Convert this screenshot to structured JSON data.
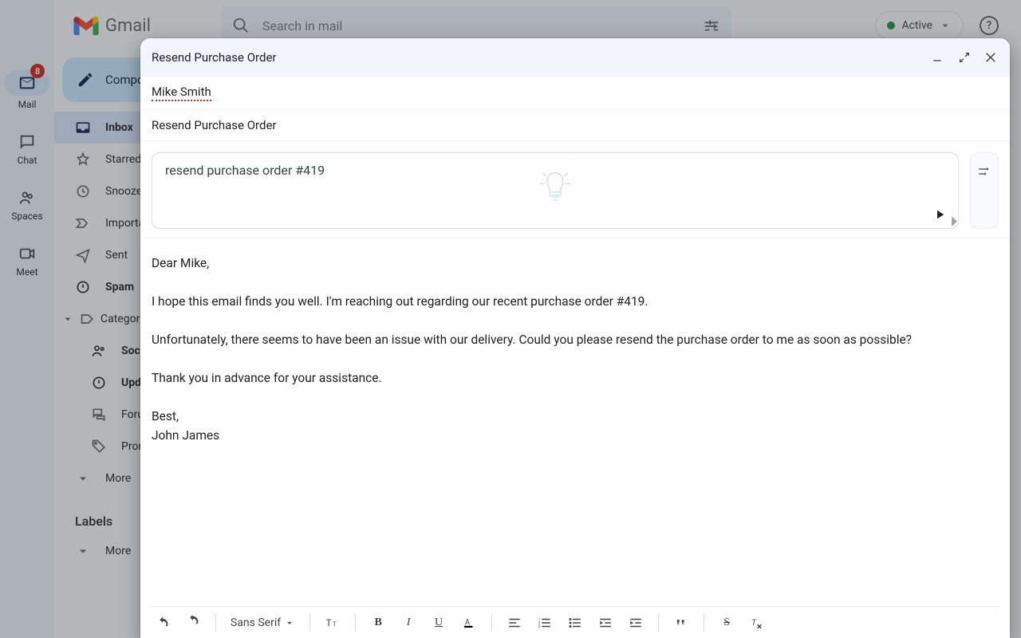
{
  "brand": {
    "name": "Gmail"
  },
  "search": {
    "placeholder": "Search in mail"
  },
  "status": {
    "active_label": "Active"
  },
  "rail": {
    "mail_badge": "8",
    "items": [
      {
        "label": "Mail"
      },
      {
        "label": "Chat"
      },
      {
        "label": "Spaces"
      },
      {
        "label": "Meet"
      }
    ]
  },
  "compose_button": {
    "label": "Compose"
  },
  "nav": {
    "items": [
      {
        "label": "Inbox"
      },
      {
        "label": "Starred"
      },
      {
        "label": "Snoozed"
      },
      {
        "label": "Important"
      },
      {
        "label": "Sent"
      },
      {
        "label": "Spam"
      },
      {
        "label": "Categories"
      },
      {
        "label": "Social"
      },
      {
        "label": "Updates"
      },
      {
        "label": "Forums"
      },
      {
        "label": "Promotions"
      },
      {
        "label": "More"
      }
    ],
    "labels_header": "Labels",
    "labels_more": "More"
  },
  "compose": {
    "window_title": "Resend Purchase Order",
    "to": "Mike Smith",
    "subject": "Resend Purchase Order",
    "ai_prompt": "resend purchase order #419",
    "body": "Dear Mike,\n\nI hope this email finds you well. I'm reaching out regarding our recent purchase order #419.\n\nUnfortunately, there seems to have been an issue with our delivery. Could you please resend the purchase order to me as soon as possible?\n\nThank you in advance for your assistance.\n\nBest,\nJohn James",
    "toolbar": {
      "font": "Sans Serif"
    }
  }
}
